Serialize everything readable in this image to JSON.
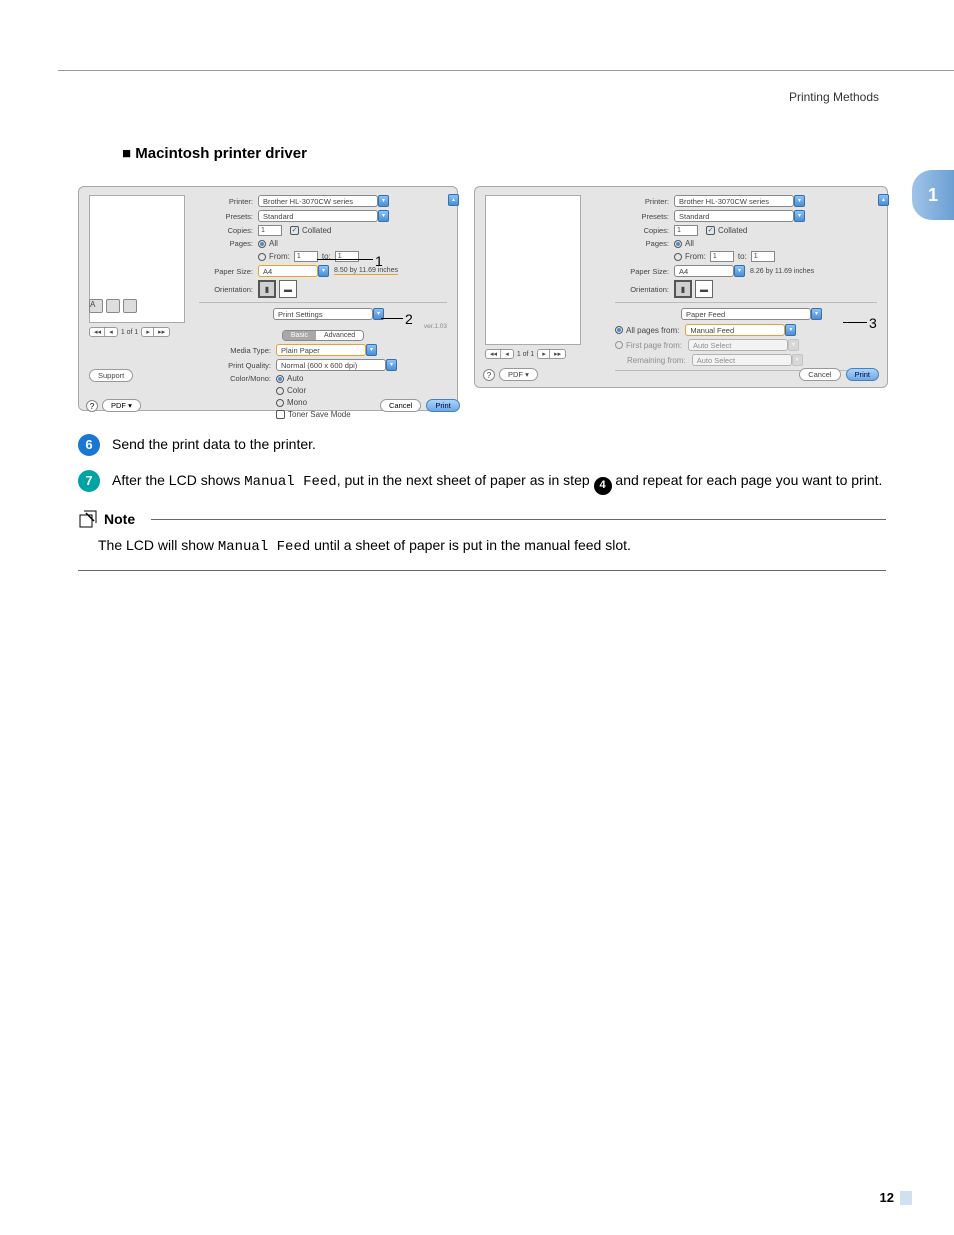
{
  "header": {
    "breadcrumb": "Printing Methods"
  },
  "chapter": "1",
  "section_title": "Macintosh printer driver",
  "dialog_left": {
    "printer_label": "Printer:",
    "printer_value": "Brother HL-3070CW series",
    "presets_label": "Presets:",
    "presets_value": "Standard",
    "copies_label": "Copies:",
    "copies_value": "1",
    "collated_label": "Collated",
    "pages_label": "Pages:",
    "pages_all": "All",
    "pages_from": "From:",
    "from_value": "1",
    "to_label": "to:",
    "to_value": "1",
    "paper_size_label": "Paper Size:",
    "paper_size_value": "A4",
    "paper_dim": "8.50 by 11.69 inches",
    "orientation_label": "Orientation:",
    "panel_select": "Print Settings",
    "panel_right_text": "ver.1.03",
    "tab_basic": "Basic",
    "tab_advanced": "Advanced",
    "media_type_label": "Media Type:",
    "media_type_value": "Plain Paper",
    "print_quality_label": "Print Quality:",
    "print_quality_value": "Normal (600 x 600 dpi)",
    "color_mono_label": "Color/Mono:",
    "cm_auto": "Auto",
    "cm_color": "Color",
    "cm_mono": "Mono",
    "toner_save": "Toner Save Mode",
    "support": "Support",
    "preview_count": "1 of 1",
    "pdf": "PDF ▾",
    "cancel": "Cancel",
    "print": "Print",
    "callout1": "1",
    "callout2": "2"
  },
  "dialog_right": {
    "printer_label": "Printer:",
    "printer_value": "Brother HL-3070CW series",
    "presets_label": "Presets:",
    "presets_value": "Standard",
    "copies_label": "Copies:",
    "copies_value": "1",
    "collated_label": "Collated",
    "pages_label": "Pages:",
    "pages_all": "All",
    "pages_from": "From:",
    "from_value": "1",
    "to_label": "to:",
    "to_value": "1",
    "paper_size_label": "Paper Size:",
    "paper_size_value": "A4",
    "paper_dim": "8.26 by 11.69 inches",
    "orientation_label": "Orientation:",
    "panel_select": "Paper Feed",
    "all_pages_from": "All pages from:",
    "all_pages_value": "Manual Feed",
    "first_page_from": "First page from:",
    "first_page_value": "Auto Select",
    "remaining_from": "Remaining from:",
    "remaining_value": "Auto Select",
    "preview_count": "1 of 1",
    "pdf": "PDF ▾",
    "cancel": "Cancel",
    "print": "Print",
    "callout3": "3"
  },
  "steps": {
    "s6_num": "6",
    "s6_text": "Send the print data to the printer.",
    "s7_num": "7",
    "s7_a": "After the LCD shows ",
    "s7_mono": "Manual Feed",
    "s7_b": ", put in the next sheet of paper as in step ",
    "s7_ref": "4",
    "s7_c": " and repeat for each page you want to print."
  },
  "note": {
    "title": "Note",
    "body_a": "The LCD will show ",
    "body_mono": "Manual Feed",
    "body_b": " until a sheet of paper is put in the manual feed slot."
  },
  "page_number": "12"
}
